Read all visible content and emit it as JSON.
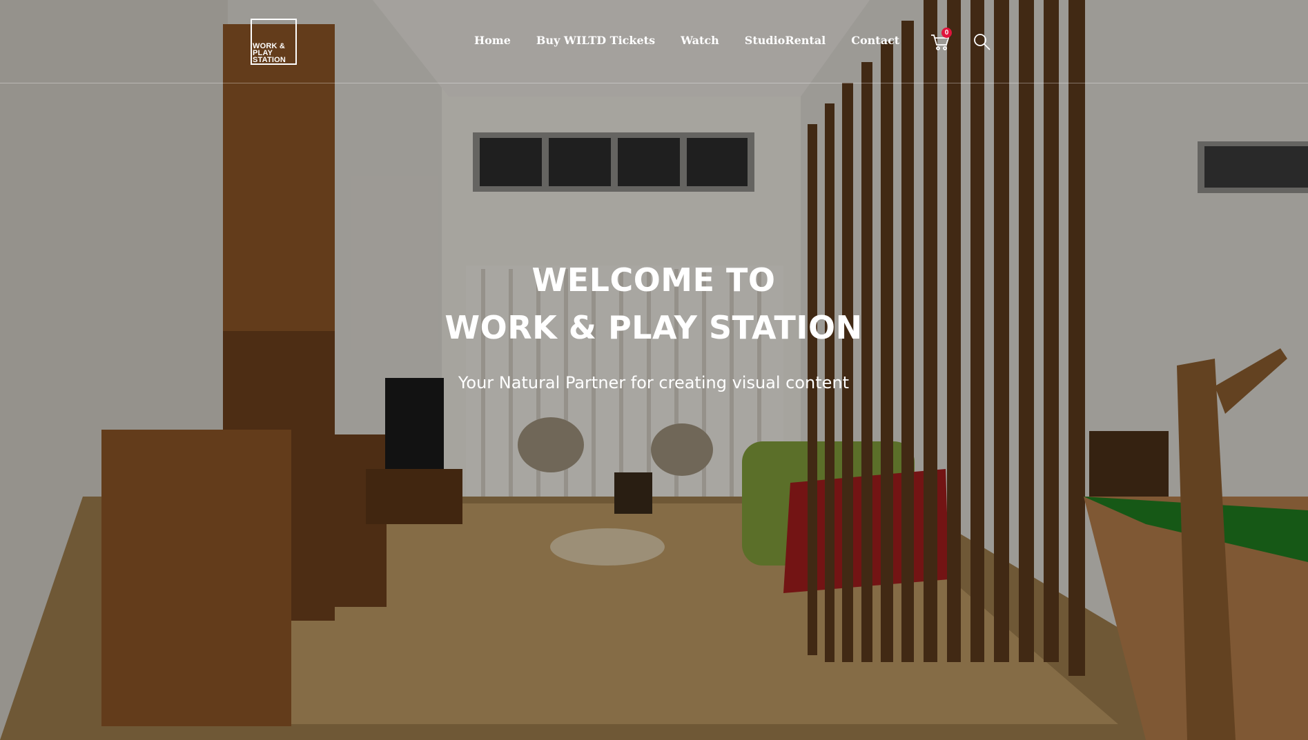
{
  "brand": {
    "logo_lines": [
      "WORK &",
      "PLAY",
      "STATION"
    ]
  },
  "nav": {
    "items": [
      "Home",
      "Buy WILTD Tickets",
      "Watch",
      "StudioRental",
      "Contact"
    ]
  },
  "cart": {
    "count": "0",
    "icon": "cart-icon"
  },
  "search": {
    "icon": "search-icon"
  },
  "hero": {
    "title_line1": "WELCOME TO",
    "title_line2": "WORK & PLAY STATION",
    "subtitle": "Your Natural Partner for creating visual content"
  },
  "colors": {
    "badge": "#e0143c",
    "text": "#ffffff"
  }
}
